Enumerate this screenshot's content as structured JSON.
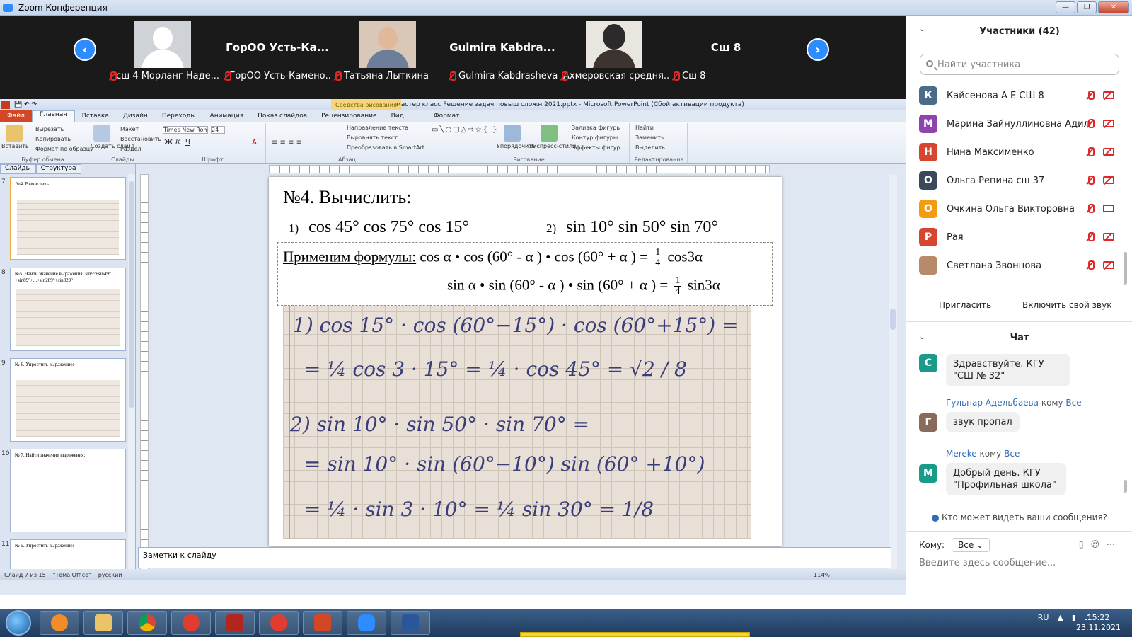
{
  "window": {
    "title": "Zoom Конференция"
  },
  "video_tiles": [
    {
      "big": "",
      "label": "сш 4  Морланг Наде..."
    },
    {
      "big": "ГорОО  Усть-Ка...",
      "label": "ГорОО Усть-Камено..."
    },
    {
      "big": "",
      "label": "Татьяна Лыткина"
    },
    {
      "big": "Gulmira  Kabdra...",
      "label": "Gulmira Kabdrasheva"
    },
    {
      "big": "",
      "label": "Ахмеровская средня..."
    },
    {
      "big": "Сш 8",
      "label": "Сш 8"
    }
  ],
  "ppt": {
    "document_title": "мастер класс Решение задач повыш сложн 2021.pptx  -  Microsoft PowerPoint (Сбой активации продукта)",
    "context_tab": "Средства рисования",
    "tabs": [
      "Файл",
      "Главная",
      "Вставка",
      "Дизайн",
      "Переходы",
      "Анимация",
      "Показ слайдов",
      "Рецензирование",
      "Вид",
      "Формат"
    ],
    "ribbon": {
      "clipboard": {
        "paste": "Вставить",
        "cut": "Вырезать",
        "copy": "Копировать",
        "format": "Формат по образцу",
        "group": "Буфер обмена"
      },
      "slides": {
        "create": "Создать слайд",
        "layout": "Макет",
        "reset": "Восстановить",
        "section": "Раздел",
        "group": "Слайды"
      },
      "font": {
        "name": "Times New Roman",
        "size": "24",
        "group": "Шрифт"
      },
      "paragraph": {
        "direction": "Направление текста",
        "align": "Выровнять текст",
        "smartart": "Преобразовать в SmartArt",
        "group": "Абзац"
      },
      "drawing": {
        "arrange": "Упорядочить",
        "styles": "Экспресс-стили",
        "fill": "Заливка фигуры",
        "outline": "Контур фигуры",
        "effects": "Эффекты фигур",
        "group": "Рисование"
      },
      "editing": {
        "find": "Найти",
        "replace": "Заменить",
        "select": "Выделить",
        "group": "Редактирование"
      }
    },
    "side_tabs": [
      "Слайды",
      "Структура"
    ],
    "thumbnails": [
      {
        "num": "7",
        "text": "№4. Вычислить"
      },
      {
        "num": "8",
        "text": "№5. Найти значение выражения: sin9°+sin49°+sin89°+...+sin289°+sin329°"
      },
      {
        "num": "9",
        "text": "№ 6. Упростить выражение:"
      },
      {
        "num": "10",
        "text": "№ 7. Найти значение выражения:"
      },
      {
        "num": "11",
        "text": "№ 9. Упростить выражение:"
      }
    ],
    "slide": {
      "heading": "№4. Вычислить:",
      "ex1_num": "1)",
      "ex1": "cos 45° cos 75° cos 15°",
      "ex2_num": "2)",
      "ex2": "sin 10° sin 50° sin 70°",
      "formula_label": "Применим  формулы:",
      "formula1_lhs": "cos α • cos (60° - α ) • cos (60° + α ) =",
      "formula1_rhs": "cos3α",
      "formula2_lhs": "sin  α • sin (60° - α ) • sin (60° + α ) =",
      "formula2_rhs": "sin3α",
      "frac_num": "1",
      "frac_den": "4",
      "hw_lines": [
        "1) cos 15° · cos (60°−15°) · cos (60°+15°) =",
        "= ¼ cos 3 · 15° = ¼ · cos 45° = √2 / 8",
        "2)  sin 10° · sin 50° · sin 70° =",
        "= sin 10° · sin (60°−10°) sin (60° +10°)",
        "= ¼ · sin 3 · 10° = ¼ sin 30° = 1/8"
      ]
    },
    "notes": "Заметки к слайду",
    "status": {
      "slide": "Слайд 7 из 15",
      "theme": "\"Тема Office\"",
      "lang": "русский",
      "zoom": "114%"
    }
  },
  "participants": {
    "header": "Участники (42)",
    "search_placeholder": "Найти участника",
    "list": [
      {
        "initial": "К",
        "name": "Кайсенова А Е СШ 8",
        "color": "#4a6b8a"
      },
      {
        "initial": "М",
        "name": "Марина Зайнуллиновна Адиль...",
        "color": "#8e44ad"
      },
      {
        "initial": "Н",
        "name": "Нина Максименко",
        "color": "#d6452f"
      },
      {
        "initial": "О",
        "name": "Ольга Репина сш 37",
        "color": "#3a4a5a"
      },
      {
        "initial": "О",
        "name": "Очкина Ольга Викторовна",
        "color": "#f39c12"
      },
      {
        "initial": "Р",
        "name": "Рая",
        "color": "#d6452f"
      },
      {
        "initial": "",
        "name": "Светлана Звонцова",
        "color": "#b88a6a"
      }
    ],
    "invite": "Пригласить",
    "unmute": "Включить свой звук"
  },
  "chat": {
    "header": "Чат",
    "messages": [
      {
        "initial": "С",
        "color": "#1a9a8a",
        "sender": "",
        "to": "",
        "recipient": "",
        "text": "Здравствуйте. КГУ \"СШ № 32\""
      },
      {
        "initial": "Г",
        "color": "#8a6a5a",
        "sender": "Гульнар Адельбаева",
        "to": "кому",
        "recipient": "Все",
        "text": "звук пропал"
      },
      {
        "initial": "М",
        "color": "#1a9a8a",
        "sender": "Mereke",
        "to": "кому",
        "recipient": "Все",
        "text": "Добрый день. КГУ \"Профильная школа\""
      }
    ],
    "who_sees": "Кто может видеть ваши сообщения?",
    "to_label": "Кому:",
    "to_value": "Все",
    "input_placeholder": "Введите здесь сообщение..."
  },
  "taskbar": {
    "lang": "RU",
    "time": "15:22",
    "date": "23.11.2021"
  }
}
